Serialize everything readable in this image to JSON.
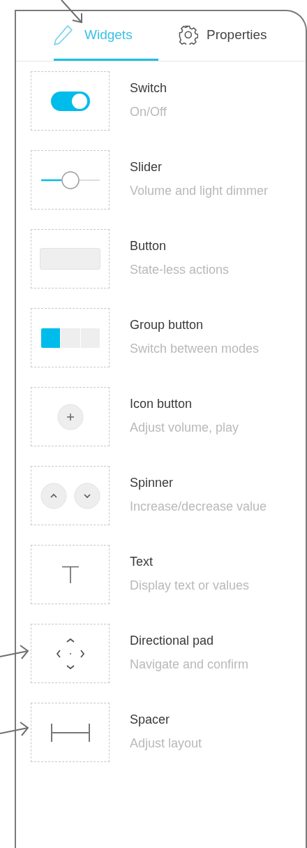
{
  "tabs": [
    {
      "label": "Widgets",
      "kind": "pencil",
      "selected": true
    },
    {
      "label": "Properties",
      "kind": "gear",
      "selected": false
    }
  ],
  "widgets": [
    {
      "kind": "switch",
      "title": "Switch",
      "subtitle": "On/Off"
    },
    {
      "kind": "slider",
      "title": "Slider",
      "subtitle": "Volume and light dimmer"
    },
    {
      "kind": "button",
      "title": "Button",
      "subtitle": "State-less actions"
    },
    {
      "kind": "group",
      "title": "Group button",
      "subtitle": "Switch between modes"
    },
    {
      "kind": "iconbutton",
      "title": "Icon button",
      "subtitle": "Adjust volume, play"
    },
    {
      "kind": "spinner",
      "title": "Spinner",
      "subtitle": "Increase/decrease value"
    },
    {
      "kind": "text",
      "title": "Text",
      "subtitle": "Display text or values"
    },
    {
      "kind": "dpad",
      "title": "Directional pad",
      "subtitle": "Navigate and confirm"
    },
    {
      "kind": "spacer",
      "title": "Spacer",
      "subtitle": "Adjust layout"
    }
  ]
}
